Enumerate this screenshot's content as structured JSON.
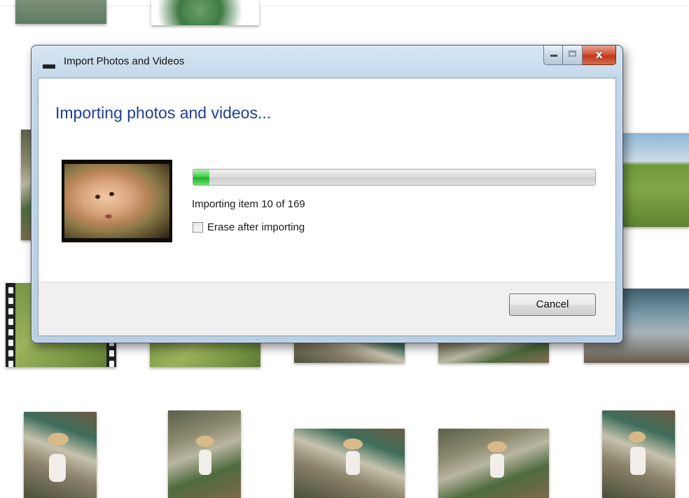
{
  "dialog": {
    "title": "Import Photos and Videos",
    "heading": "Importing photos and videos...",
    "progress_fraction": 0.04,
    "status": "Importing item 10 of 169",
    "erase_checkbox": {
      "label": "Erase after importing",
      "checked": false
    },
    "cancel_label": "Cancel",
    "caption_buttons": [
      "minimize-icon",
      "maximize-icon",
      "close-icon"
    ],
    "close_glyph": "x",
    "colors": {
      "heading": "#1f3d99",
      "progress": "#22b02a",
      "close_button": "#c0391d"
    }
  },
  "background_gallery": {
    "items": [
      "photo",
      "photo",
      "photo",
      "photo",
      "video",
      "photo",
      "photo",
      "photo",
      "photo",
      "photo",
      "photo",
      "photo",
      "photo",
      "photo",
      "photo"
    ]
  }
}
